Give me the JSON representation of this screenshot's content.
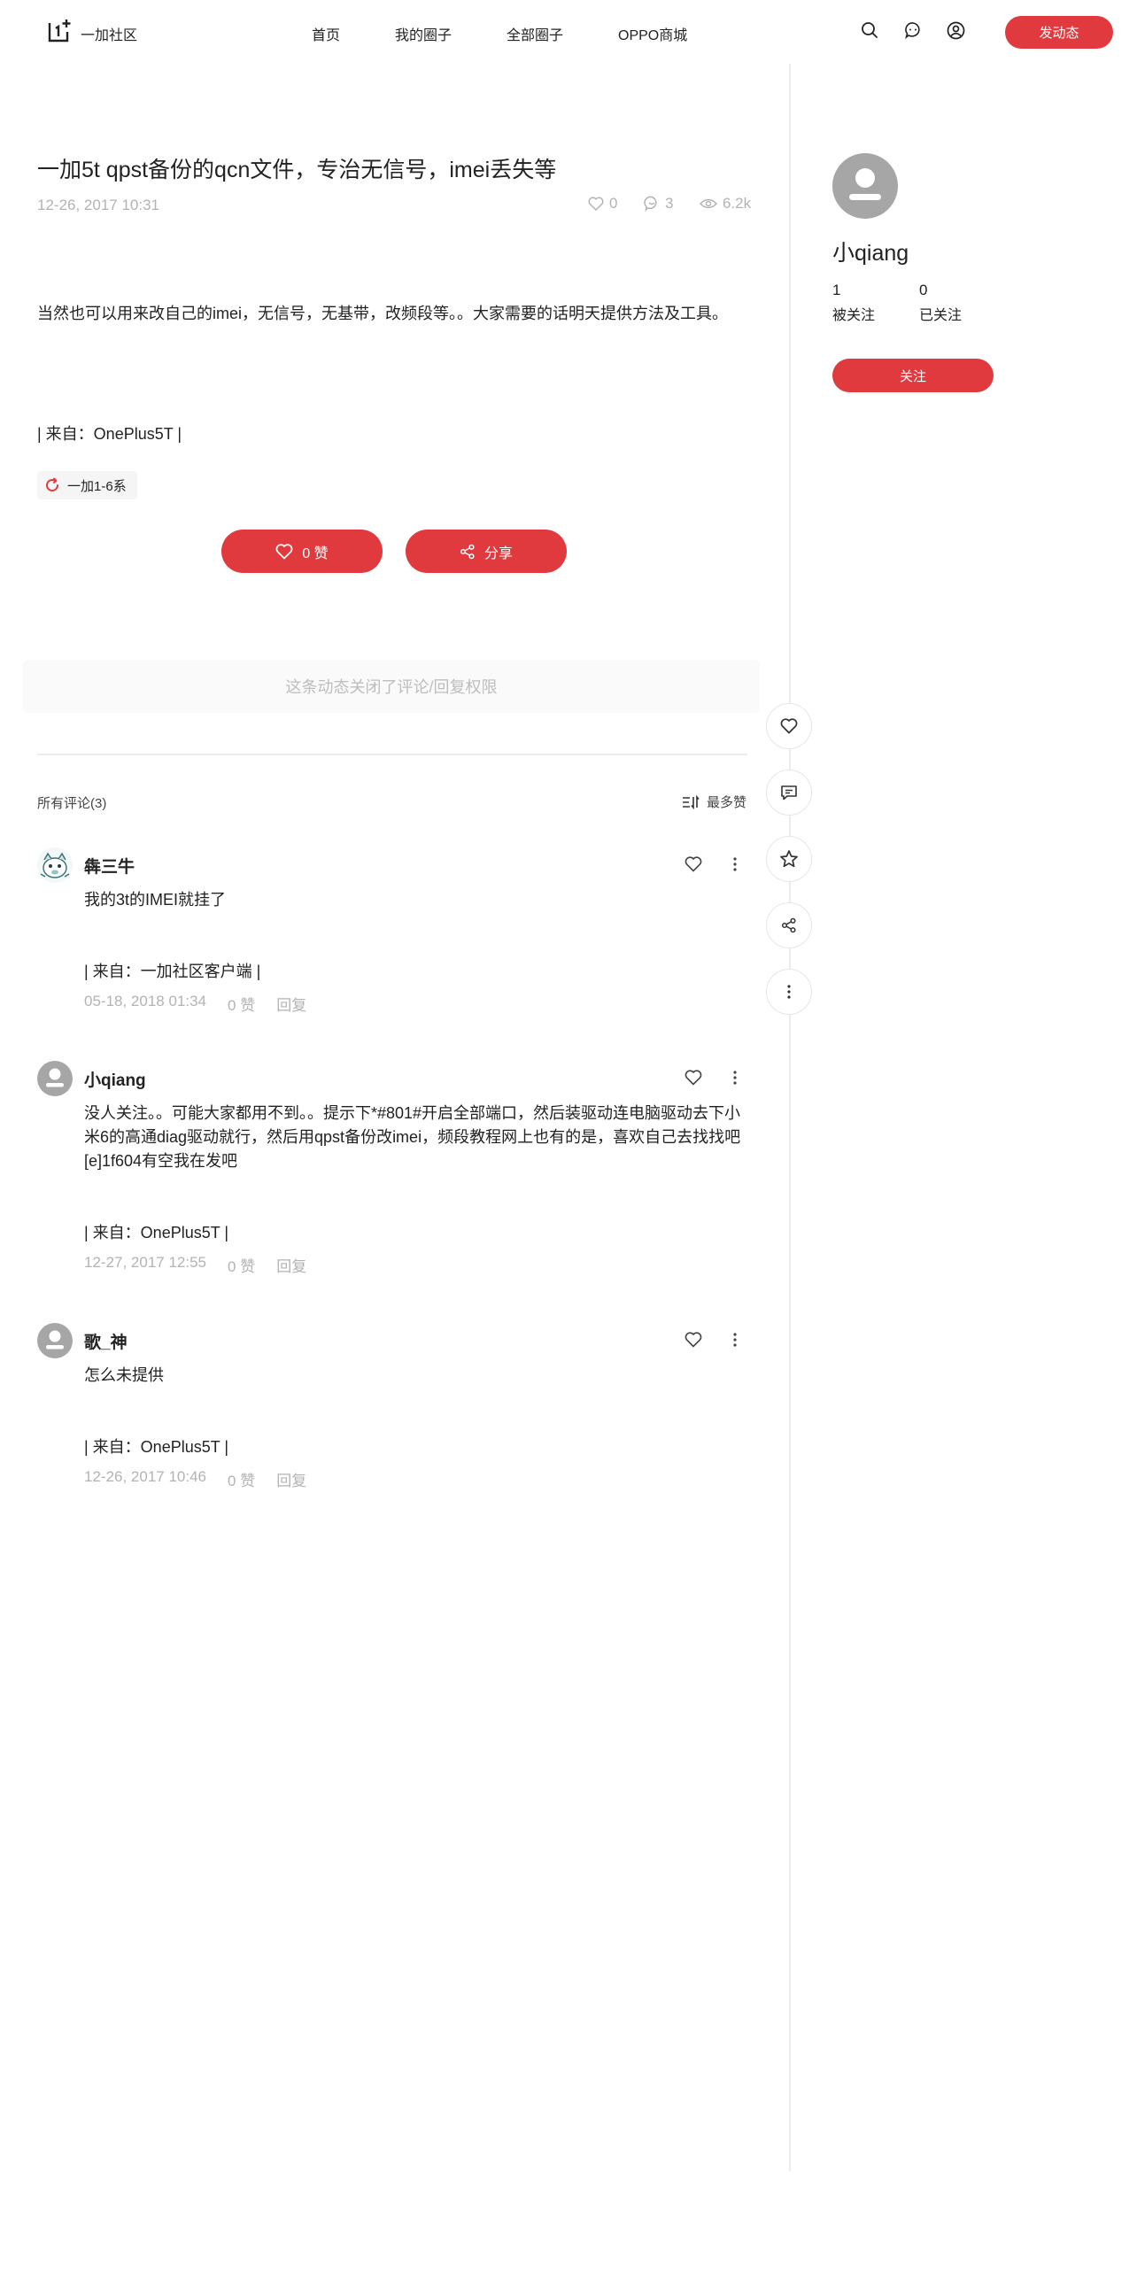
{
  "header": {
    "brand": "一加社区",
    "nav": [
      "首页",
      "我的圈子",
      "全部圈子",
      "OPPO商城"
    ],
    "post_button": "发动态"
  },
  "post": {
    "title": "一加5t qpst备份的qcn文件，专治无信号，imei丢失等",
    "date": "12-26, 2017 10:31",
    "likes": "0",
    "comments": "3",
    "views": "6.2k",
    "body": "当然也可以用来改自己的imei，无信号，无基带，改频段等。。大家需要的话明天提供方法及工具。",
    "source": "| 来自：OnePlus5T |",
    "tag": "一加1-6系",
    "like_button": "0 赞",
    "share_button": "分享",
    "comments_closed": "这条动态关闭了评论/回复权限"
  },
  "comments_section": {
    "count_label": "所有评论(3)",
    "sort_label": "最多赞"
  },
  "comments": [
    {
      "name": "犇三牛",
      "text": "我的3t的IMEI就挂了",
      "source": "| 来自：一加社区客户端 |",
      "date": "05-18, 2018 01:34",
      "likes": "0 赞",
      "reply": "回复"
    },
    {
      "name": "小qiang",
      "text": "没人关注。。可能大家都用不到。。提示下*#801#开启全部端口，然后装驱动连电脑驱动去下小米6的高通diag驱动就行，然后用qpst备份改imei，频段教程网上也有的是，喜欢自己去找找吧[e]1f604有空我在发吧",
      "source": "| 来自：OnePlus5T |",
      "date": "12-27, 2017 12:55",
      "likes": "0 赞",
      "reply": "回复"
    },
    {
      "name": "歌_神",
      "text": "怎么未提供",
      "source": "| 来自：OnePlus5T |",
      "date": "12-26, 2017 10:46",
      "likes": "0 赞",
      "reply": "回复"
    }
  ],
  "profile": {
    "name": "小qiang",
    "followers": "1",
    "followers_label": "被关注",
    "following": "0",
    "following_label": "已关注",
    "follow_button": "关注"
  },
  "colors": {
    "accent": "#e0393e",
    "muted": "#b3b3b3",
    "avatar_gray": "#a6a6a6"
  }
}
